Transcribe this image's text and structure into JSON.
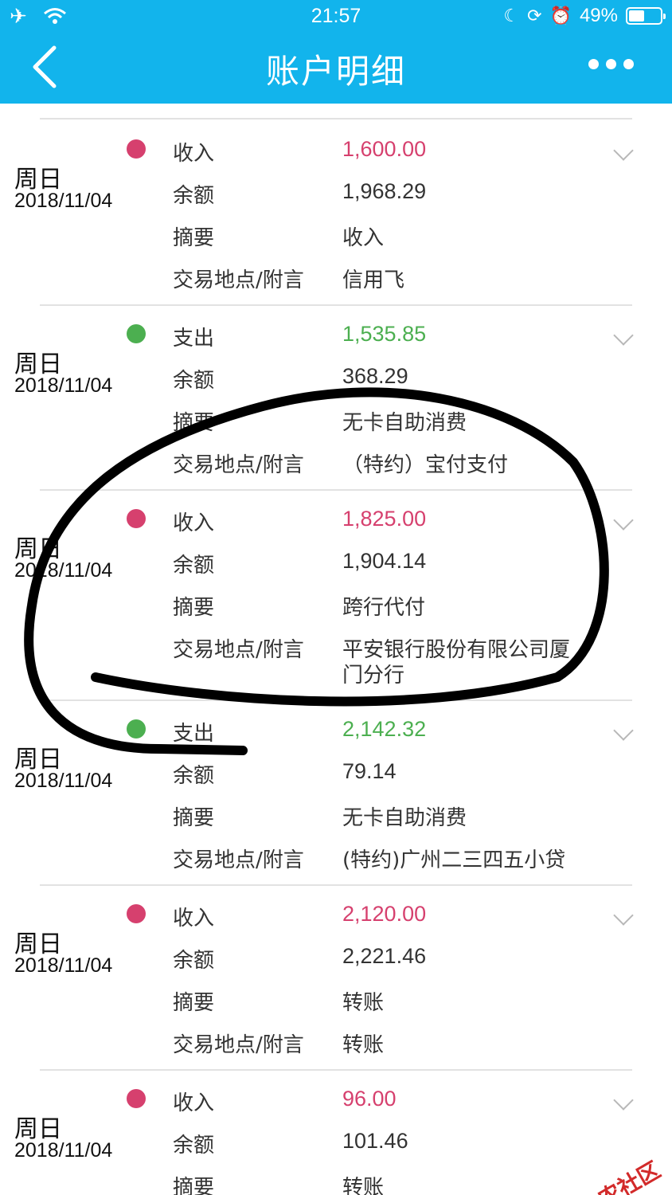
{
  "status_bar": {
    "time": "21:57",
    "battery_text": "49%",
    "battery_level": 0.49,
    "icons": [
      "airplane-icon",
      "wifi-icon",
      "moon-icon",
      "rotation-lock-icon",
      "alarm-icon",
      "battery-icon"
    ]
  },
  "nav": {
    "title": "账户明细",
    "back_icon": "chevron-left-icon",
    "more_icon": "more-dots-icon"
  },
  "labels": {
    "balance": "余额",
    "summary": "摘要",
    "location": "交易地点/附言"
  },
  "colors": {
    "header": "#12b4ec",
    "income": "#d6406e",
    "expense": "#4caf50"
  },
  "transactions": [
    {
      "day": "周日",
      "date": "2018/11/04",
      "type": "收入",
      "amount": "1,600.00",
      "balance": "1,968.29",
      "summary": "收入",
      "location": "信用飞"
    },
    {
      "day": "周日",
      "date": "2018/11/04",
      "type": "支出",
      "amount": "1,535.85",
      "balance": "368.29",
      "summary": "无卡自助消费",
      "location": "（特约）宝付支付"
    },
    {
      "day": "周日",
      "date": "2018/11/04",
      "type": "收入",
      "amount": "1,825.00",
      "balance": "1,904.14",
      "summary": "跨行代付",
      "location": "平安银行股份有限公司厦",
      "location_line2": "门分行"
    },
    {
      "day": "周日",
      "date": "2018/11/04",
      "type": "支出",
      "amount": "2,142.32",
      "balance": "79.14",
      "summary": "无卡自助消费",
      "location": "(特约)广州二三四五小贷"
    },
    {
      "day": "周日",
      "date": "2018/11/04",
      "type": "收入",
      "amount": "2,120.00",
      "balance": "2,221.46",
      "summary": "转账",
      "location": "转账"
    },
    {
      "day": "周日",
      "date": "2018/11/04",
      "type": "收入",
      "amount": "96.00",
      "balance": "101.46",
      "summary": "转账"
    }
  ],
  "watermark": "卡农社区"
}
